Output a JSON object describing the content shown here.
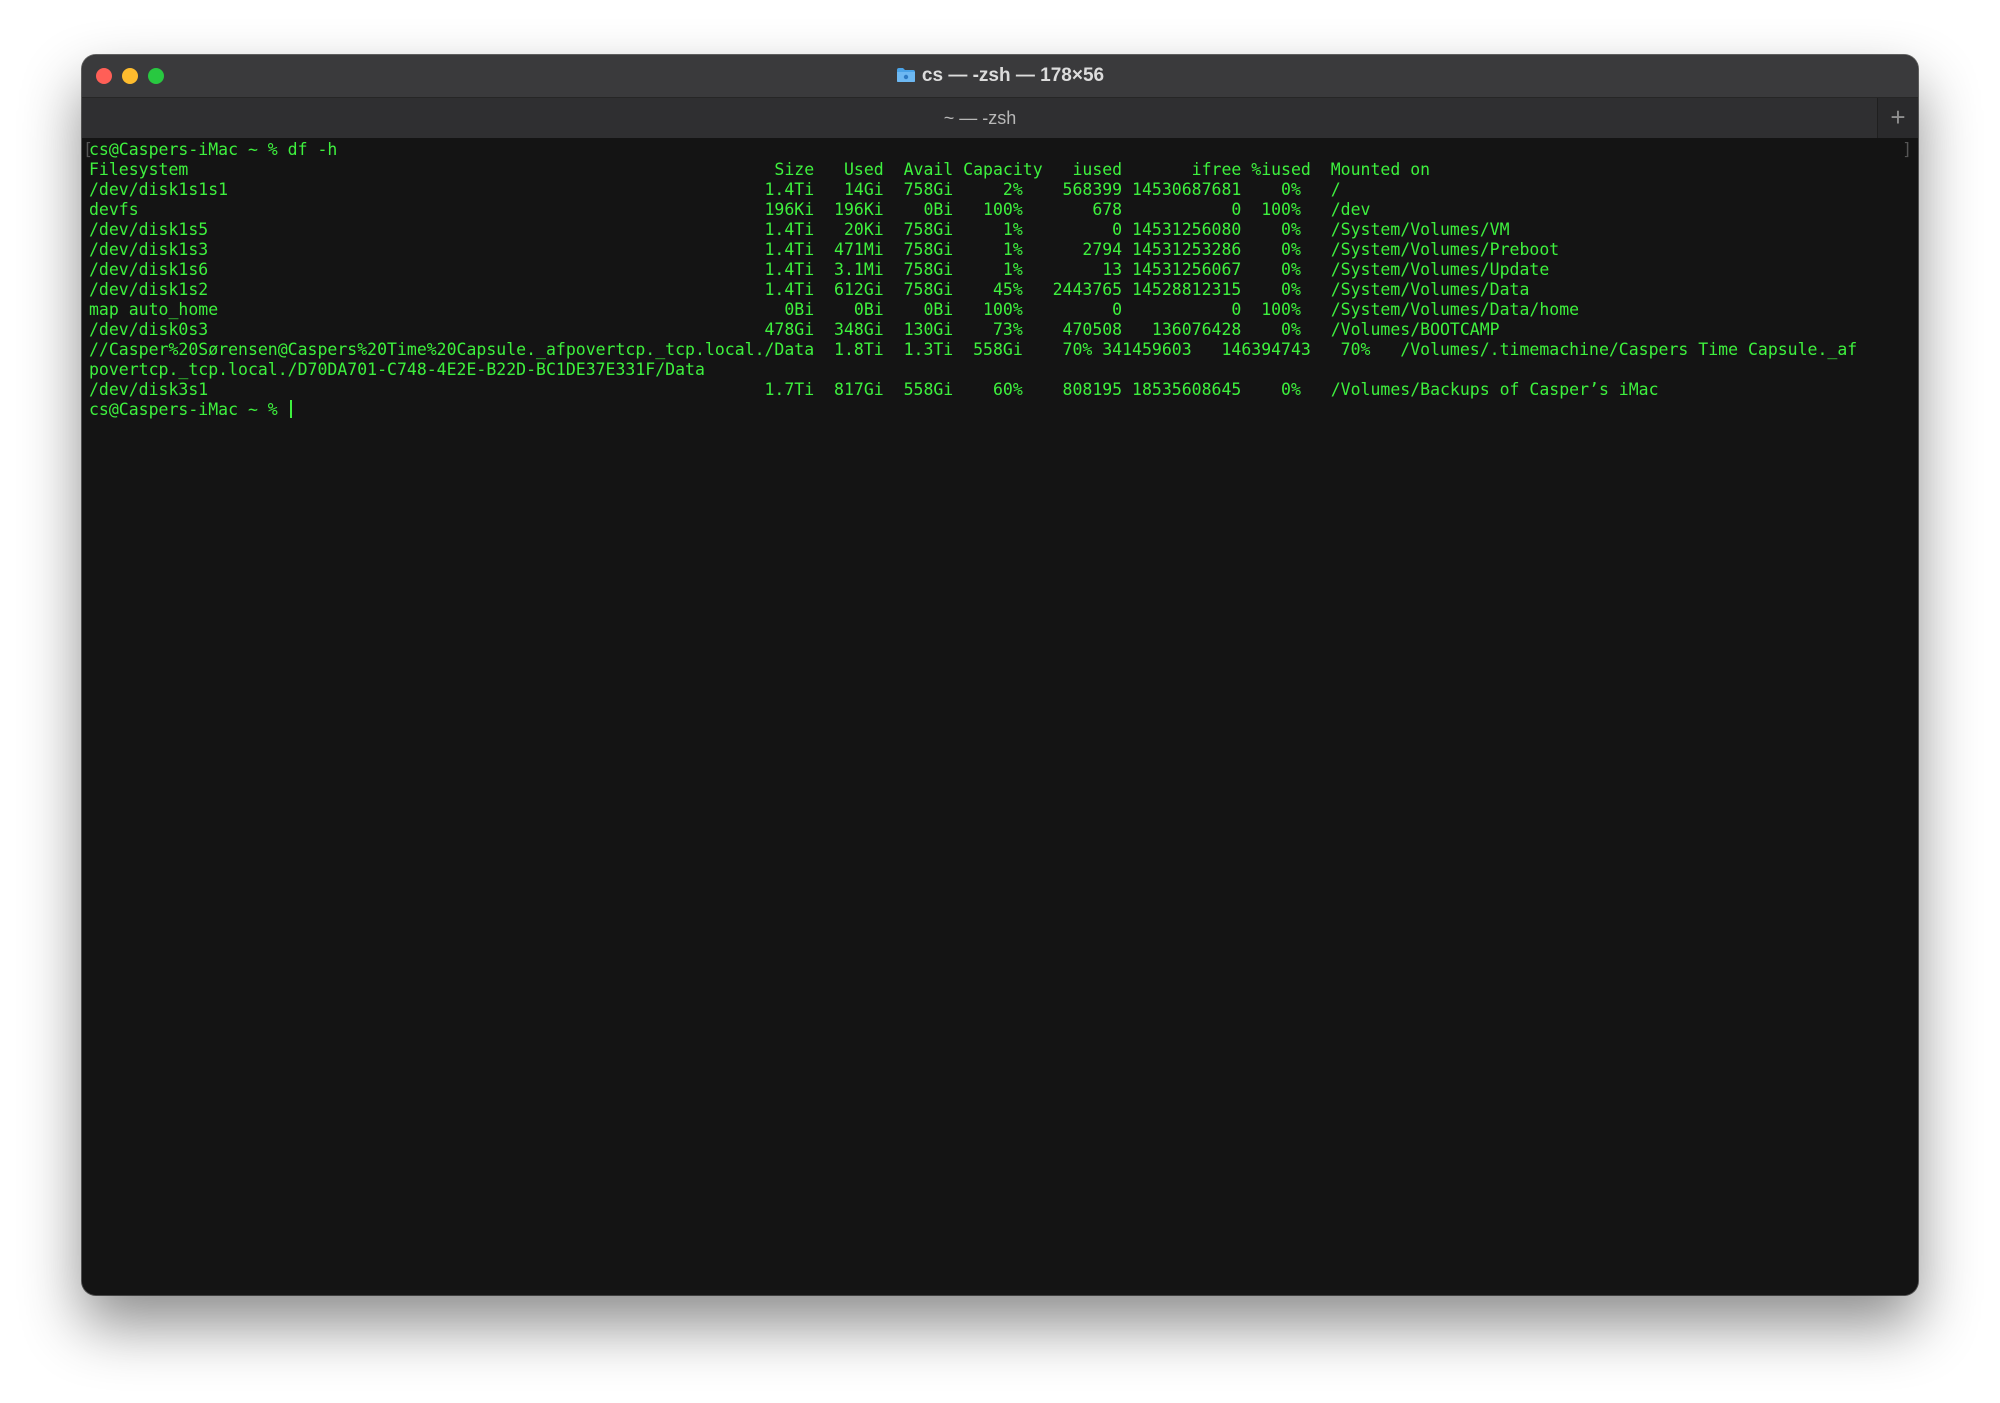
{
  "window": {
    "title": "cs — -zsh — 178×56",
    "tab_label": "~ — -zsh",
    "add_tab_label": "+"
  },
  "terminal": {
    "lines": [
      "cs@Caspers-iMac ~ % df -h",
      "Filesystem                                                           Size   Used  Avail Capacity   iused       ifree %iused  Mounted on",
      "/dev/disk1s1s1                                                      1.4Ti   14Gi  758Gi     2%    568399 14530687681    0%   /",
      "devfs                                                               196Ki  196Ki    0Bi   100%       678           0  100%   /dev",
      "/dev/disk1s5                                                        1.4Ti   20Ki  758Gi     1%         0 14531256080    0%   /System/Volumes/VM",
      "/dev/disk1s3                                                        1.4Ti  471Mi  758Gi     1%      2794 14531253286    0%   /System/Volumes/Preboot",
      "/dev/disk1s6                                                        1.4Ti  3.1Mi  758Gi     1%        13 14531256067    0%   /System/Volumes/Update",
      "/dev/disk1s2                                                        1.4Ti  612Gi  758Gi    45%   2443765 14528812315    0%   /System/Volumes/Data",
      "map auto_home                                                         0Bi    0Bi    0Bi   100%         0           0  100%   /System/Volumes/Data/home",
      "/dev/disk0s3                                                        478Gi  348Gi  130Gi    73%    470508   136076428    0%   /Volumes/BOOTCAMP",
      "//Casper%20Sørensen@Caspers%20Time%20Capsule._afpovertcp._tcp.local./Data  1.8Ti  1.3Ti  558Gi    70% 341459603   146394743   70%   /Volumes/.timemachine/Caspers Time Capsule._af",
      "povertcp._tcp.local./D70DA701-C748-4E2E-B22D-BC1DE37E331F/Data",
      "/dev/disk3s1                                                        1.7Ti  817Gi  558Gi    60%    808195 18535608645    0%   /Volumes/Backups of Casper’s iMac",
      "cs@Caspers-iMac ~ % "
    ]
  }
}
